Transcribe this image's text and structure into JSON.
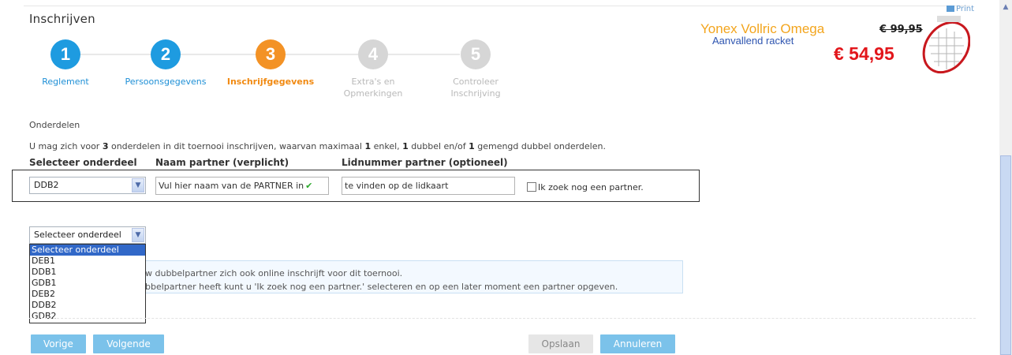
{
  "page": {
    "title": "Inschrijven"
  },
  "steps": [
    {
      "number": "1",
      "label": "Reglement",
      "state": "done"
    },
    {
      "number": "2",
      "label": "Persoonsgegevens",
      "state": "done"
    },
    {
      "number": "3",
      "label": "Inschrijfgegevens",
      "state": "active"
    },
    {
      "number": "4",
      "label": "Extra's en\nOpmerkingen",
      "state": "todo"
    },
    {
      "number": "5",
      "label": "Controleer\nInschrijving",
      "state": "todo"
    }
  ],
  "ad": {
    "print_label": "Print",
    "product": "Yonex Vollric Omega",
    "subtitle": "Aanvallend racket",
    "old_price": "€ 99,95",
    "new_price": "€ 54,95"
  },
  "section": {
    "label": "Onderdelen",
    "intro_1": "U mag zich voor ",
    "intro_n": "3",
    "intro_2": " onderdelen in dit toernooi inschrijven, waarvan maximaal ",
    "intro_a": "1",
    "intro_3": " enkel, ",
    "intro_b": "1",
    "intro_4": " dubbel en/of ",
    "intro_c": "1",
    "intro_5": " gemengd dubbel onderdelen."
  },
  "columns": {
    "onderdeel": "Selecteer onderdeel",
    "partner": "Naam partner (verplicht)",
    "lidnummer": "Lidnummer partner (optioneel)"
  },
  "row1": {
    "onderdeel_value": "DDB2",
    "partner_value": "Vul hier naam van de PARTNER in",
    "lidnummer_value": "te vinden op de lidkaart",
    "search_partner_label": "Ik zoek nog een partner."
  },
  "row2": {
    "onderdeel_value": "Selecteer onderdeel"
  },
  "dropdown": {
    "options": [
      "Selecteer onderdeel",
      "DEB1",
      "DDB1",
      "GDB1",
      "DEB2",
      "DDB2",
      "GDB2"
    ]
  },
  "info": {
    "line1": "w dubbelpartner zich ook online inschrijft voor dit toernooi.",
    "line2": "bbelpartner heeft kunt u 'Ik zoek nog een partner.' selecteren en op een later moment een partner opgeven."
  },
  "buttons": {
    "prev": "Vorige",
    "next": "Volgende",
    "save": "Opslaan",
    "cancel": "Annuleren"
  },
  "colors": {
    "step_done": "#1e9be0",
    "step_active": "#f39225",
    "step_todo": "#d6d6d6",
    "button": "#7bc2ea",
    "price": "#e2161b"
  }
}
